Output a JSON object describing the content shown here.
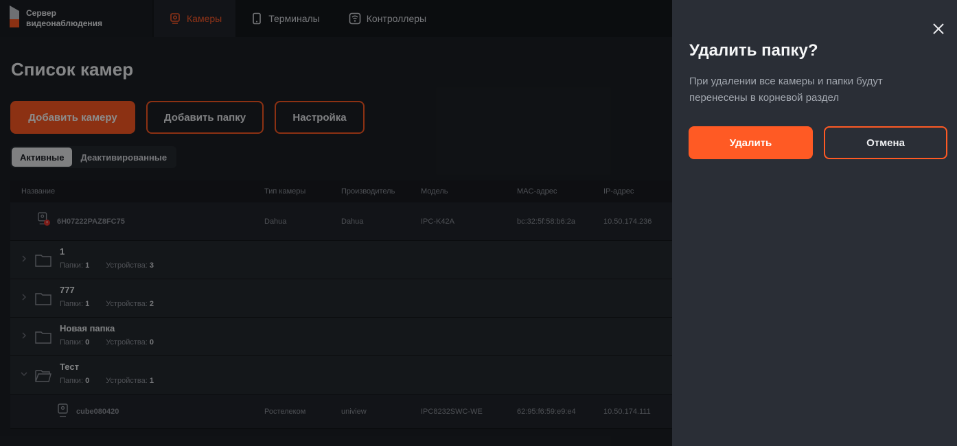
{
  "brand": {
    "line1": "Сервер",
    "line2": "видеонаблюдения",
    "accent": "#ff5a24"
  },
  "nav": [
    {
      "label": "Камеры",
      "icon": "camera-icon",
      "active": true
    },
    {
      "label": "Терминалы",
      "icon": "tablet-icon",
      "active": false
    },
    {
      "label": "Контроллеры",
      "icon": "controller-icon",
      "active": false
    }
  ],
  "page": {
    "title": "Список камер",
    "add_camera": "Добавить камеру",
    "add_folder": "Добавить папку",
    "settings": "Настройка",
    "tabs": [
      "Активные",
      "Деактивированные"
    ]
  },
  "table": {
    "columns": [
      "Название",
      "Тип камеры",
      "Производитель",
      "Модель",
      "MAC-адрес",
      "IP-адрес"
    ],
    "camera": {
      "name": "6H07222PAZ8FC75",
      "type": "Dahua",
      "vendor": "Dahua",
      "model": "IPC-K42A",
      "mac": "bc:32:5f:58:b6:2a",
      "ip": "10.50.174.236"
    },
    "meta_labels": {
      "folders": "Папки:",
      "devices": "Устройства:"
    },
    "folders": [
      {
        "name": "1",
        "folders": "1",
        "devices": "3"
      },
      {
        "name": "777",
        "folders": "1",
        "devices": "2"
      },
      {
        "name": "Новая папка",
        "folders": "0",
        "devices": "0"
      },
      {
        "name": "Тест",
        "folders": "0",
        "devices": "1"
      }
    ],
    "sub_camera": {
      "name": "cube080420",
      "type": "Ростелеком",
      "vendor": "uniview",
      "model": "IPC8232SWC-WE",
      "mac": "62:95:f6:59:e9:e4",
      "ip": "10.50.174.111"
    }
  },
  "dialog": {
    "title": "Удалить папку?",
    "description": "При удалении все камеры и папки будут перенесены в корневой раздел",
    "delete": "Удалить",
    "cancel": "Отмена"
  }
}
